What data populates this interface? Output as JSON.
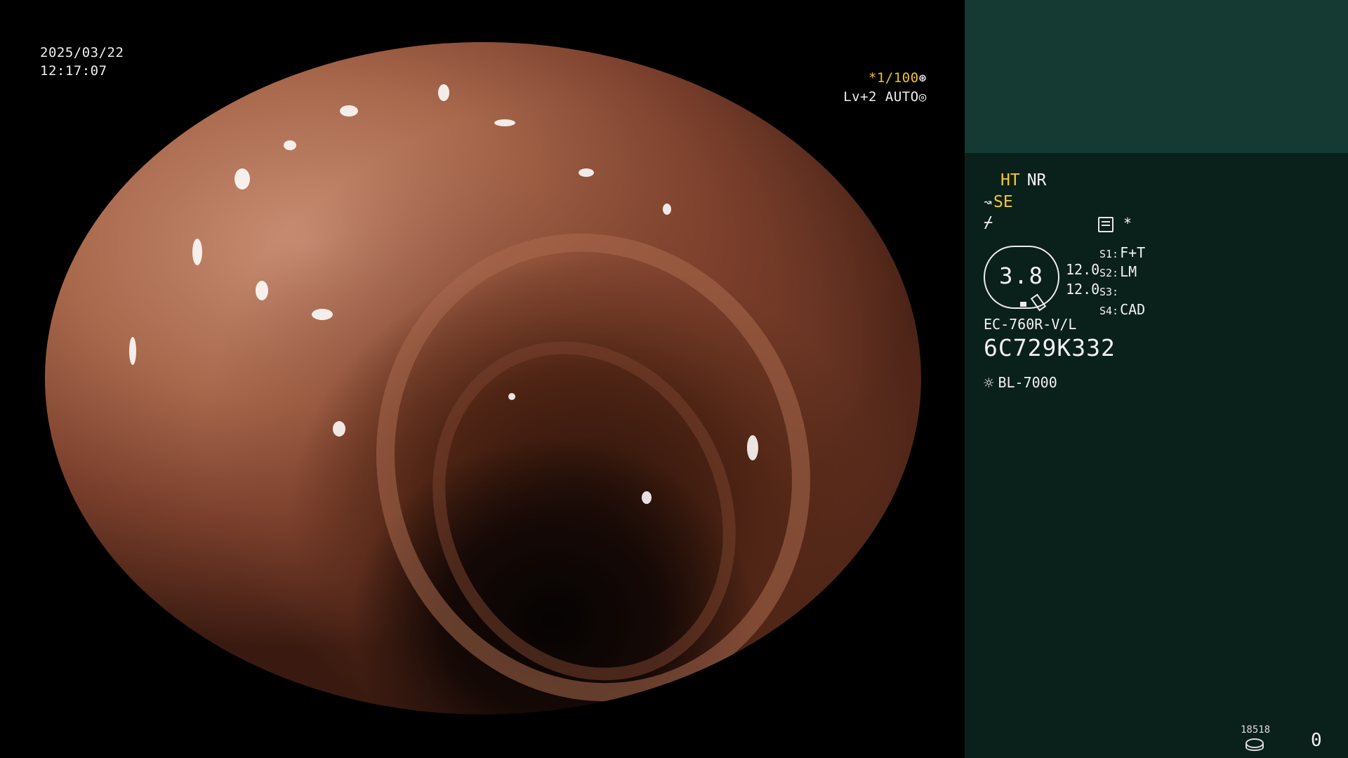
{
  "video": {
    "date": "2025/03/22",
    "time": "12:17:07",
    "shutter": "*1/100",
    "shutter_icon": "aperture-icon",
    "level": "Lv+2 AUTO",
    "level_icon": "iris-icon"
  },
  "panel": {
    "ht_label": "HT",
    "nr_label": "NR",
    "se_label": "SE",
    "se_icon": "enhancement-icon",
    "f_icon": "scissor-icon",
    "memory_icon": "memory-card-icon",
    "asterisk": "*",
    "gauge_value": "3.8",
    "val_a": "12.0",
    "val_b": "12.0",
    "s_items": [
      {
        "key": "S1:",
        "value": "F+T"
      },
      {
        "key": "S2:",
        "value": "LM"
      },
      {
        "key": "S3:",
        "value": ""
      },
      {
        "key": "S4:",
        "value": "CAD"
      }
    ],
    "model": "EC-760R-V/L",
    "serial": "6C729K332",
    "light_icon": "light-source-icon",
    "light_source": "BL-7000",
    "counter_small": "18518",
    "storage_icon": "storage-disk-icon",
    "counter_big": "0"
  },
  "colors": {
    "panel_bg": "#0a201b",
    "panel_top": "#143a33",
    "accent_yellow": "#f5c72d"
  }
}
